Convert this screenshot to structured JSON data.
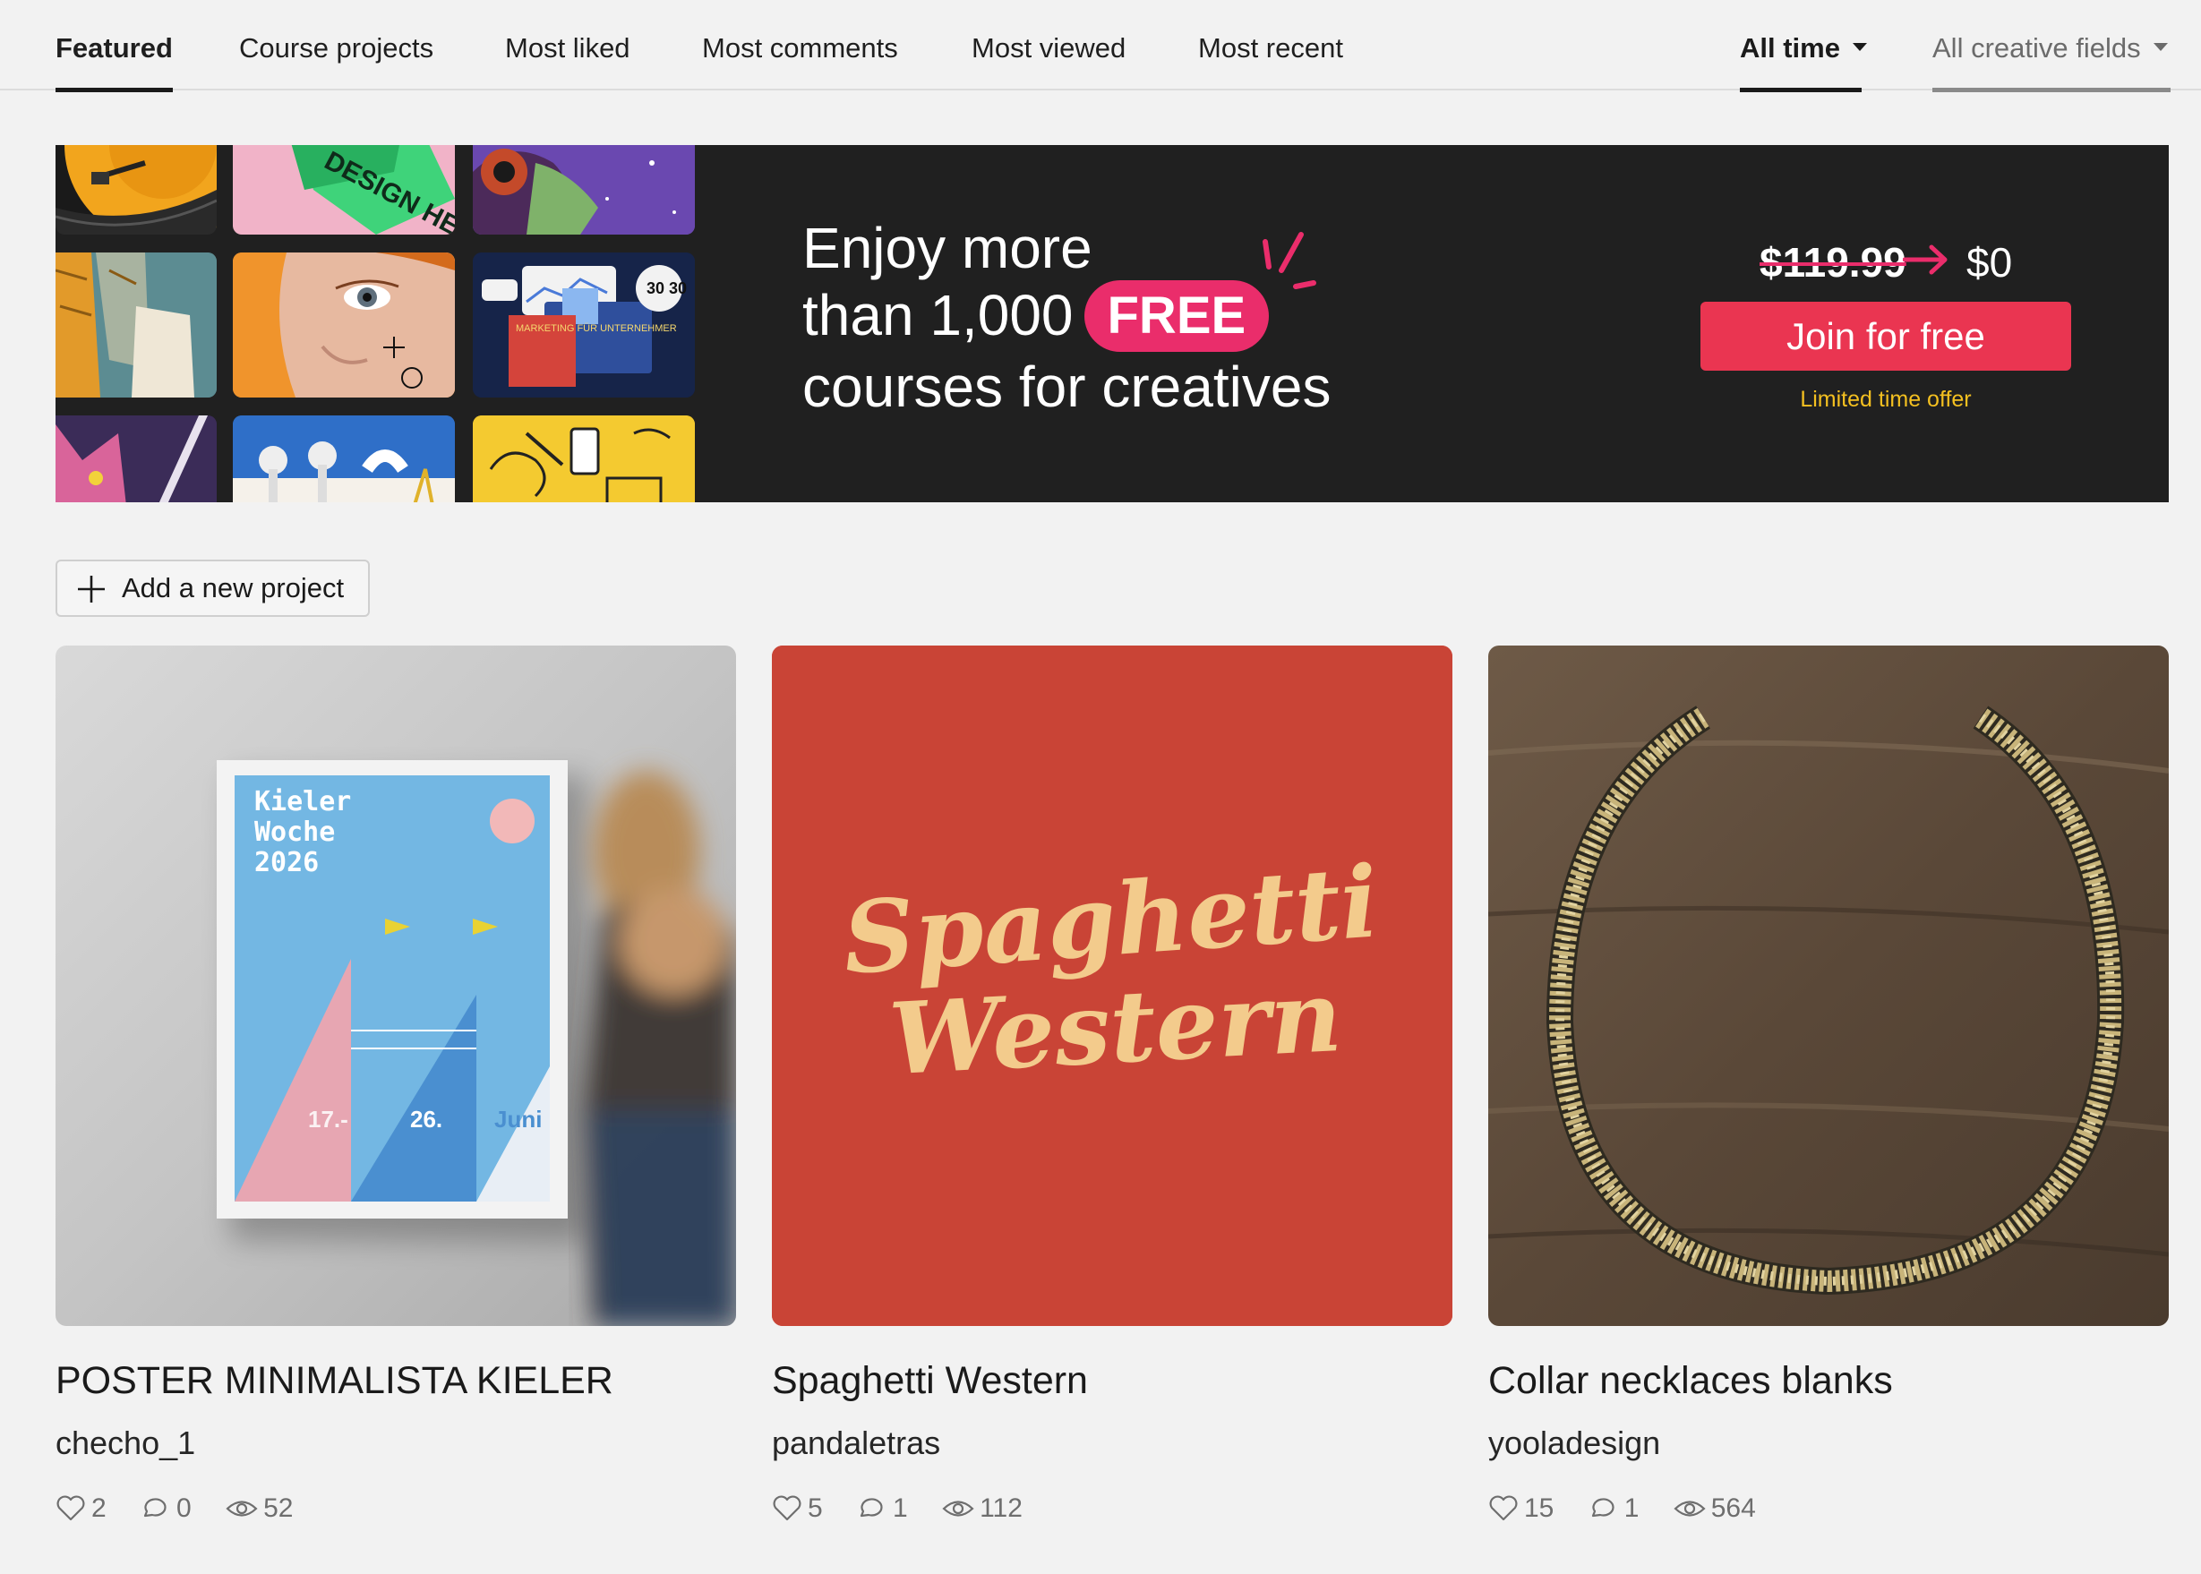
{
  "tabs": [
    {
      "label": "Featured",
      "active": true
    },
    {
      "label": "Course projects"
    },
    {
      "label": "Most liked"
    },
    {
      "label": "Most comments"
    },
    {
      "label": "Most viewed"
    },
    {
      "label": "Most recent"
    }
  ],
  "filters": {
    "time": "All time",
    "fields": "All creative fields"
  },
  "banner": {
    "line1": "Enjoy more",
    "line2": "than 1,000",
    "free": "FREE",
    "line3": "courses for creatives",
    "old_price": "$119.99",
    "new_price": "$0",
    "cta": "Join for free",
    "note": "Limited time offer",
    "colors": {
      "accent": "#ea2d6b",
      "button": "#ea3551",
      "note": "#f4c020",
      "background": "#202020"
    },
    "tile_text": {
      "design": "DESIGN HERE",
      "marketing": "MARKETING FÜR UNTERNEHMER",
      "badge": "30 30"
    }
  },
  "add_project": "Add a new project",
  "projects": [
    {
      "title": "POSTER MINIMALISTA KIELER",
      "author": "checho_1",
      "likes": "2",
      "comments": "0",
      "views": "52",
      "poster": {
        "heading": "Kieler Woche 2026",
        "d1": "17.-",
        "d2": "26.",
        "d3": "Juni"
      }
    },
    {
      "title": "Spaghetti Western",
      "author": "pandaletras",
      "likes": "5",
      "comments": "1",
      "views": "112",
      "art": {
        "line1": "Spaghetti",
        "line2": "Western"
      }
    },
    {
      "title": "Collar necklaces blanks",
      "author": "yooladesign",
      "likes": "15",
      "comments": "1",
      "views": "564"
    }
  ]
}
